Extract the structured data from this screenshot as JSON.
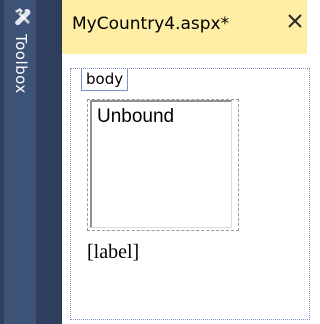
{
  "toolbox": {
    "label": "Toolbox",
    "icon": "toolbox-icon"
  },
  "document_tab": {
    "title": "MyCountry4.aspx*",
    "close_icon": "close-icon",
    "accent_color": "#ffeea6"
  },
  "design_surface": {
    "body_tag": "body",
    "listbox": {
      "items": [
        "Unbound"
      ]
    },
    "label_text": "[label]"
  }
}
